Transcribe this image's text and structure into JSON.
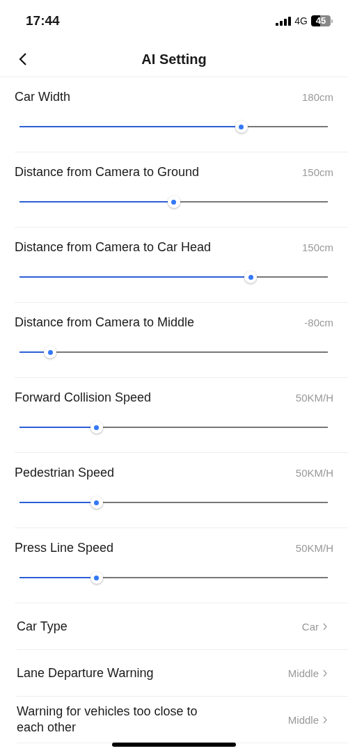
{
  "status_bar": {
    "time": "17:44",
    "network": "4G",
    "battery": "45"
  },
  "header": {
    "title": "AI Setting"
  },
  "sliders": [
    {
      "label": "Car Width",
      "reading": "180cm",
      "level": 0.72
    },
    {
      "label": "Distance from Camera to Ground",
      "reading": "150cm",
      "level": 0.5
    },
    {
      "label": "Distance from Camera to Car Head",
      "reading": "150cm",
      "level": 0.75
    },
    {
      "label": "Distance from Camera to Middle",
      "reading": "-80cm",
      "level": 0.1
    },
    {
      "label": "Forward Collision Speed",
      "reading": "50KM/H",
      "level": 0.25
    },
    {
      "label": "Pedestrian Speed",
      "reading": "50KM/H",
      "level": 0.25
    },
    {
      "label": "Press Line Speed",
      "reading": "50KM/H",
      "level": 0.25
    }
  ],
  "options": [
    {
      "label": "Car Type",
      "value": "Car"
    },
    {
      "label": "Lane Departure Warning",
      "value": "Middle"
    },
    {
      "label": "Warning for vehicles too close to each other",
      "value": "Middle"
    }
  ]
}
